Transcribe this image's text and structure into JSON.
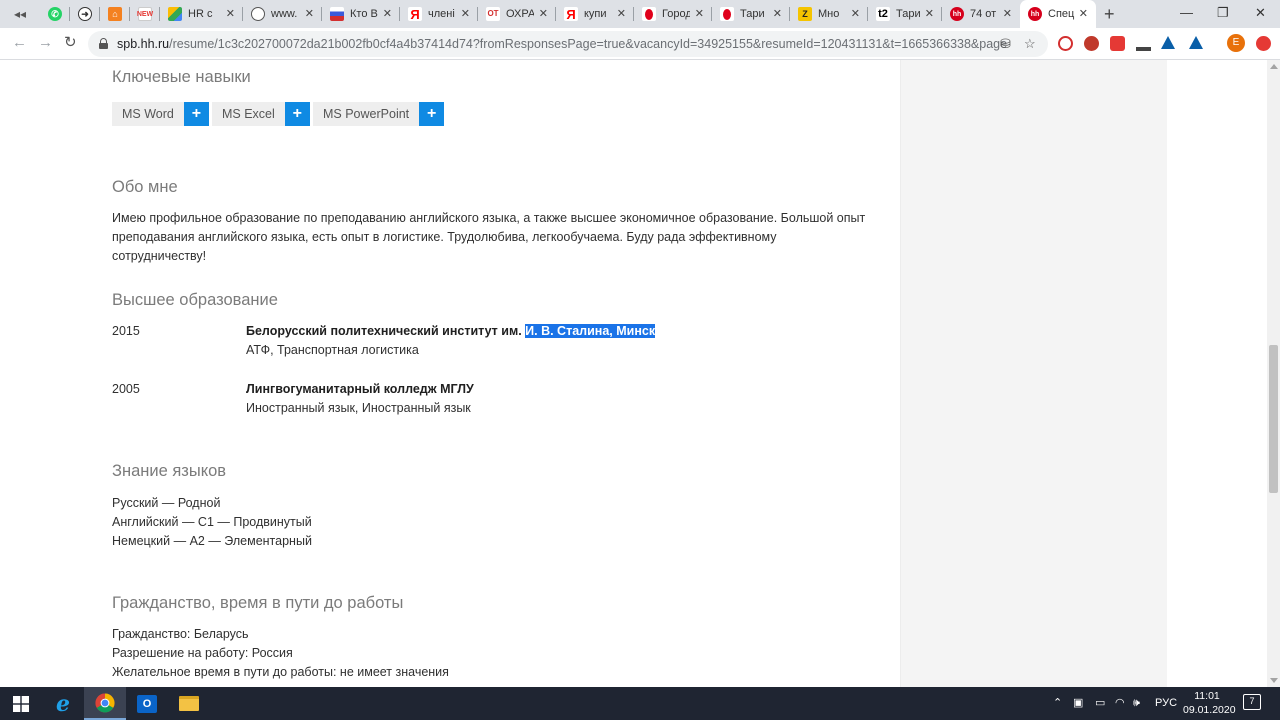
{
  "browser": {
    "tabs": [
      {
        "title": "",
        "favicon": "back-arrow-icon",
        "color": "#dee1e6"
      },
      {
        "title": "",
        "favicon": "whatsapp-icon",
        "color": "#25d366"
      },
      {
        "title": "",
        "favicon": "forward-circle-icon",
        "color": "#444444"
      },
      {
        "title": "",
        "favicon": "orange-square-icon",
        "color": "#f48120"
      },
      {
        "title": "",
        "favicon": "news-icon",
        "color": "#e53935"
      },
      {
        "title": "HR c",
        "favicon": "drive-icon",
        "color": "#fbbc04"
      },
      {
        "title": "www.",
        "favicon": "globe-icon",
        "color": "#555555"
      },
      {
        "title": "Кто B",
        "favicon": "flag-icon",
        "color": "#3b5bdb"
      },
      {
        "title": "члені",
        "favicon": "yandex-icon",
        "color": "#ff0000"
      },
      {
        "title": "ОХРА",
        "favicon": "ohr-icon",
        "color": "#d32f2f"
      },
      {
        "title": "купи",
        "favicon": "yandex-icon",
        "color": "#ff0000"
      },
      {
        "title": "Город",
        "favicon": "red-dot-icon",
        "color": "#e0001b"
      },
      {
        "title": "Тари",
        "favicon": "red-dot-icon",
        "color": "#e0001b"
      },
      {
        "title": "Мно",
        "favicon": "z-icon",
        "color": "#f5c400"
      },
      {
        "title": "Тари",
        "favicon": "t2-icon",
        "color": "#000000"
      },
      {
        "title": "74 от",
        "favicon": "hh-icon",
        "color": "#d6001c"
      },
      {
        "title": "Спец",
        "favicon": "hh-icon",
        "color": "#d6001c"
      }
    ],
    "url_host": "spb.hh.ru",
    "url_rest": "/resume/1c3c202700072da21b002fb0cf4a4b37414d74?fromResponsesPage=true&vacancyId=34925155&resumeId=120431131&t=1665366338&page=0&c...",
    "profile_initial": "E"
  },
  "resume": {
    "skills_heading": "Ключевые навыки",
    "skills": [
      "MS Word",
      "MS Excel",
      "MS PowerPoint"
    ],
    "skill_add": "+",
    "about_heading": "Обо мне",
    "about_text": "Имею профильное образование по преподаванию английского языка, а также высшее экономичное образование. Большой опыт преподавания английского языка, есть опыт в логистике. Трудолюбива, легкообучаема. Буду рада эффективному сотрудничеству!",
    "education_heading": "Высшее образование",
    "education": [
      {
        "year": "2015",
        "title_plain": "Белорусский политехнический институт им. ",
        "title_selected": "И. В. Сталина, Минск",
        "detail": "АТФ, Транспортная логистика"
      },
      {
        "year": "2005",
        "title_plain": "Лингвогуманитарный колледж МГЛУ",
        "title_selected": "",
        "detail": "Иностранный язык, Иностранный язык"
      }
    ],
    "languages_heading": "Знание языков",
    "languages": [
      "Русский — Родной",
      "Английский — C1 — Продвинутый",
      "Немецкий — A2 — Элементарный"
    ],
    "citizenship_heading": "Гражданство, время в пути до работы",
    "citizenship": [
      "Гражданство: Беларусь",
      "Разрешение на работу: Россия",
      "Желательное время в пути до работы: не имеет значения"
    ]
  },
  "taskbar": {
    "language": "РУС",
    "time": "11:01",
    "date": "09.01.2020",
    "notifications": "7"
  }
}
